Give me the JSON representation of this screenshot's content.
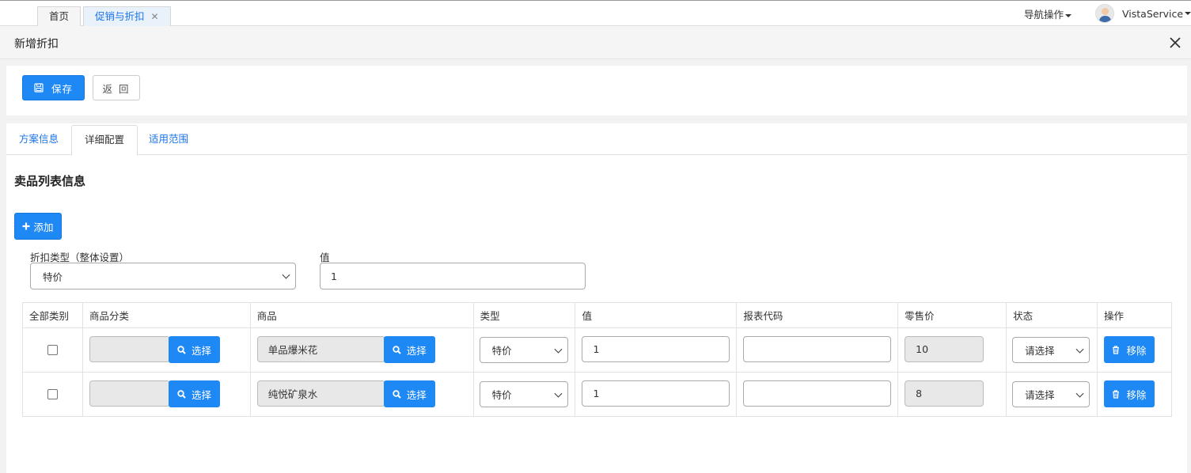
{
  "top_tabs": [
    {
      "label": "首页"
    },
    {
      "label": "促销与折扣"
    }
  ],
  "nav_ops": "导航操作",
  "user": "VistaService",
  "panel_title": "新增折扣",
  "toolbar": {
    "save": "保存",
    "back": "返 回"
  },
  "tabs": [
    "方案信息",
    "详细配置",
    "适用范围"
  ],
  "section_title": "卖品列表信息",
  "add_button": "添加",
  "discount_type_label": "折扣类型（整体设置）",
  "discount_type_value": "特价",
  "value_label": "值",
  "value_input": "1",
  "table": {
    "headers": [
      "全部类别",
      "商品分类",
      "商品",
      "类型",
      "值",
      "报表代码",
      "零售价",
      "状态",
      "操作"
    ],
    "select_label": "选择",
    "remove_label": "移除",
    "rows": [
      {
        "category": "",
        "product": "单品爆米花",
        "type": "特价",
        "value": "1",
        "report_code": "",
        "price": "10",
        "status": "请选择"
      },
      {
        "category": "",
        "product": "纯悦矿泉水",
        "type": "特价",
        "value": "1",
        "report_code": "",
        "price": "8",
        "status": "请选择"
      }
    ]
  }
}
